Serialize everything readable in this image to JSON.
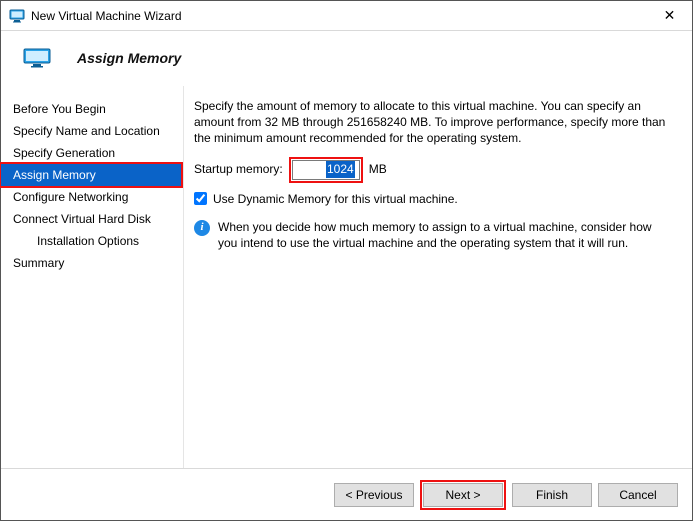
{
  "window": {
    "title": "New Virtual Machine Wizard",
    "close_glyph": "✕"
  },
  "header": {
    "title": "Assign Memory"
  },
  "sidebar": {
    "steps": [
      "Before You Begin",
      "Specify Name and Location",
      "Specify Generation",
      "Assign Memory",
      "Configure Networking",
      "Connect Virtual Hard Disk",
      "Installation Options",
      "Summary"
    ],
    "selected_index": 3,
    "sub_index": 6
  },
  "content": {
    "intro": "Specify the amount of memory to allocate to this virtual machine. You can specify an amount from 32 MB through 251658240 MB. To improve performance, specify more than the minimum amount recommended for the operating system.",
    "memory_label": "Startup memory:",
    "memory_value": "1024",
    "memory_unit": "MB",
    "dynamic_checkbox_label": "Use Dynamic Memory for this virtual machine.",
    "dynamic_checked": true,
    "info_text": "When you decide how much memory to assign to a virtual machine, consider how you intend to use the virtual machine and the operating system that it will run."
  },
  "footer": {
    "previous": "< Previous",
    "next": "Next >",
    "finish": "Finish",
    "cancel": "Cancel"
  }
}
